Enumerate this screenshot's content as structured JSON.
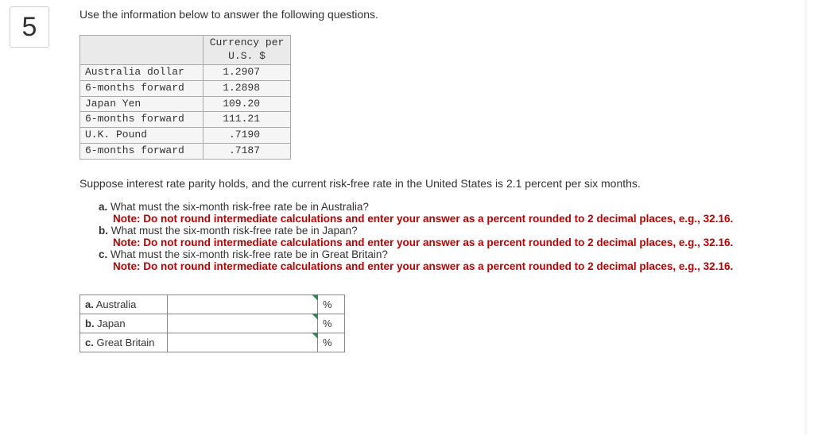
{
  "question_number": "5",
  "intro_text": "Use the information below to answer the following questions.",
  "currency_table": {
    "header_line1": "Currency per",
    "header_line2": "U.S. $",
    "rows": [
      {
        "label": "Australia dollar",
        "value": "1.2907"
      },
      {
        "label": "6-months forward",
        "value": "1.2898"
      },
      {
        "label": "Japan Yen",
        "value": "109.20"
      },
      {
        "label": "6-months forward",
        "value": "111.21"
      },
      {
        "label": "U.K. Pound",
        "value": ".7190"
      },
      {
        "label": "6-months forward",
        "value": ".7187"
      }
    ]
  },
  "irp_text": "Suppose interest rate parity holds, and the current risk-free rate in the United States is 2.1 percent per six months.",
  "sub_questions": {
    "a_label": "a.",
    "a_text": " What must the six-month risk-free rate be in Australia?",
    "a_note": "Note: Do not round intermediate calculations and enter your answer as a percent rounded to 2 decimal places, e.g., 32.16.",
    "b_label": "b.",
    "b_text": " What must the six-month risk-free rate be in Japan?",
    "b_note": "Note: Do not round intermediate calculations and enter your answer as a percent rounded to 2 decimal places, e.g., 32.16.",
    "c_label": "c.",
    "c_text": " What must the six-month risk-free rate be in Great Britain?",
    "c_note": "Note: Do not round intermediate calculations and enter your answer as a percent rounded to 2 decimal places, e.g., 32.16."
  },
  "answer_table": {
    "rows": [
      {
        "label_bold": "a.",
        "label_rest": " Australia",
        "unit": "%"
      },
      {
        "label_bold": "b.",
        "label_rest": " Japan",
        "unit": "%"
      },
      {
        "label_bold": "c.",
        "label_rest": " Great Britain",
        "unit": "%"
      }
    ]
  }
}
